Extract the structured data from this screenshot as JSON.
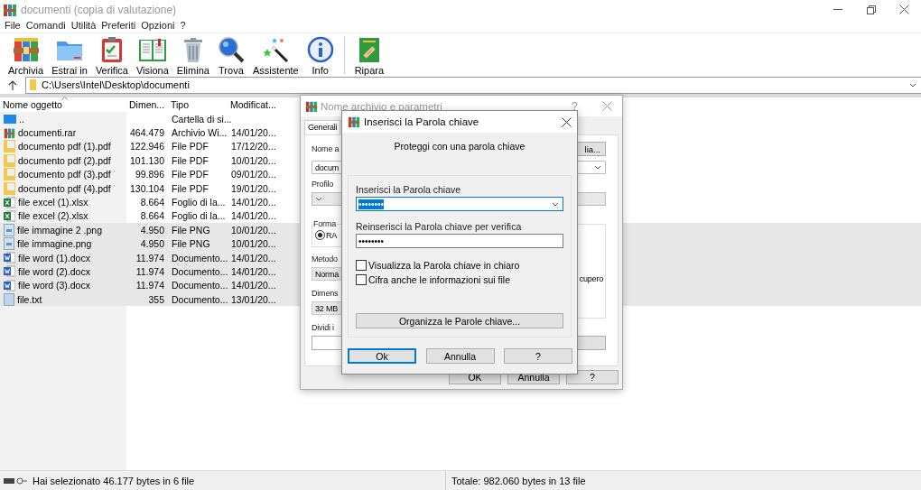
{
  "window": {
    "title": "documenti (copia di valutazione)"
  },
  "menu": [
    "File",
    "Comandi",
    "Utilità",
    "Preferiti",
    "Opzioni",
    "?"
  ],
  "toolbar": [
    {
      "label": "Archivia",
      "kind": "archive"
    },
    {
      "label": "Estrai in",
      "kind": "extract"
    },
    {
      "label": "Verifica",
      "kind": "verify"
    },
    {
      "label": "Visiona",
      "kind": "view"
    },
    {
      "label": "Elimina",
      "kind": "delete"
    },
    {
      "label": "Trova",
      "kind": "find"
    },
    {
      "label": "Assistente",
      "kind": "wizard"
    },
    {
      "label": "Info",
      "kind": "info"
    },
    {
      "label": "Ripara",
      "kind": "repair"
    }
  ],
  "address": {
    "path": "C:\\Users\\Intel\\Desktop\\documenti"
  },
  "table": {
    "columns": [
      "Nome oggetto",
      "Dimen...",
      "Tipo",
      "Modificat..."
    ],
    "rows": [
      {
        "kind": "up",
        "name": "..",
        "type": "Cartella di si...",
        "selected": false
      },
      {
        "kind": "rar",
        "name": "documenti.rar",
        "size": "464.479",
        "type": "Archivio Wi...",
        "modified": "14/01/20...",
        "selected": false
      },
      {
        "kind": "pdf",
        "name": "documento pdf (1).pdf",
        "size": "122.946",
        "type": "File PDF",
        "modified": "17/12/20...",
        "selected": false
      },
      {
        "kind": "pdf",
        "name": "documento pdf (2).pdf",
        "size": "101.130",
        "type": "File PDF",
        "modified": "10/01/20...",
        "selected": false
      },
      {
        "kind": "pdf",
        "name": "documento pdf (3).pdf",
        "size": "99.896",
        "type": "File PDF",
        "modified": "09/01/20...",
        "selected": false
      },
      {
        "kind": "pdf",
        "name": "documento pdf (4).pdf",
        "size": "130.104",
        "type": "File PDF",
        "modified": "19/01/20...",
        "selected": false
      },
      {
        "kind": "excel",
        "name": "file excel (1).xlsx",
        "size": "8.664",
        "type": "Foglio di la...",
        "modified": "14/01/20...",
        "selected": false
      },
      {
        "kind": "excel",
        "name": "file excel (2).xlsx",
        "size": "8.664",
        "type": "Foglio di la...",
        "modified": "14/01/20...",
        "selected": false
      },
      {
        "kind": "image",
        "name": "file immagine 2 .png",
        "size": "4.950",
        "type": "File PNG",
        "modified": "10/01/20...",
        "selected": true
      },
      {
        "kind": "image",
        "name": "file immagine.png",
        "size": "4.950",
        "type": "File PNG",
        "modified": "10/01/20...",
        "selected": true
      },
      {
        "kind": "word",
        "name": "file word (1).docx",
        "size": "11.974",
        "type": "Documento...",
        "modified": "14/01/20...",
        "selected": true
      },
      {
        "kind": "word",
        "name": "file word (2).docx",
        "size": "11.974",
        "type": "Documento...",
        "modified": "14/01/20...",
        "selected": true
      },
      {
        "kind": "word",
        "name": "file word (3).docx",
        "size": "11.974",
        "type": "Documento...",
        "modified": "14/01/20...",
        "selected": true
      },
      {
        "kind": "text",
        "name": "file.txt",
        "size": "355",
        "type": "Documento...",
        "modified": "13/01/20...",
        "selected": true
      }
    ]
  },
  "status_bar": {
    "selection": "Hai selezionato 46.177 bytes in 6 file",
    "total": "Totale: 982.060 bytes in 13 file"
  },
  "archive_dialog": {
    "title": "Nome archivio e parametri",
    "help": "?",
    "tabs": [
      {
        "label": "Generali",
        "selected": true
      }
    ],
    "name_label": "Nome a",
    "browse_button": "lia...",
    "name_value": "docum",
    "profile_label": "Profilo",
    "format_label": "Forma",
    "format_radio": {
      "label": "RA",
      "selected": true
    },
    "side_text": "cupero",
    "method_label": "Metodo",
    "method_value": "Norma",
    "dict_label": "Dimens",
    "dict_value": "32 MB",
    "split_label": "Dividi i",
    "buttons": [
      "OK",
      "Annulla",
      "?"
    ]
  },
  "password_dialog": {
    "title": "Inserisci la Parola chiave",
    "heading": "Proteggi con una parola chiave",
    "password": {
      "label": "Inserisci la Parola chiave",
      "value": "••••••••",
      "selected": true
    },
    "confirm": {
      "label": "Reinserisci la Parola chiave per verifica",
      "value": "••••••••"
    },
    "options": [
      {
        "label": "Visualizza la Parola chiave in chiaro",
        "checked": false
      },
      {
        "label": "Cifra anche le informazioni sui file",
        "checked": false
      }
    ],
    "organize_button": "Organizza le Parole chiave...",
    "buttons": [
      {
        "label": "Ok",
        "focused": true
      },
      {
        "label": "Annulla",
        "focused": false
      },
      {
        "label": "?",
        "focused": false
      }
    ]
  }
}
